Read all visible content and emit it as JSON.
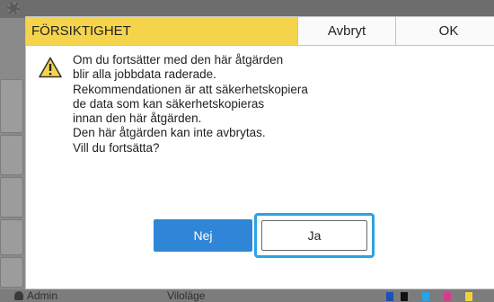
{
  "background": {
    "user": "Admin",
    "status": "Viloläge",
    "ink_colors": [
      "#1e4fb3",
      "#111111",
      "#2aa2e6",
      "#d43c8c",
      "#f2d23a"
    ]
  },
  "dialog": {
    "title": "FÖRSIKTIGHET",
    "title_color": "#f5d44c",
    "cancel_label": "Avbryt",
    "ok_label": "OK",
    "icon": "warning-icon",
    "message_lines": [
      "Om du fortsätter med den här åtgärden",
      "blir alla jobbdata raderade.",
      "Rekommendationen är att säkerhetskopiera",
      "de data som kan säkerhetskopieras",
      "innan den här åtgärden.",
      "Den här åtgärden kan inte avbrytas.",
      "Vill du fortsätta?"
    ],
    "no_label": "Nej",
    "no_color": "#2f86d6",
    "yes_label": "Ja",
    "focus_color": "#2aa2e6"
  }
}
